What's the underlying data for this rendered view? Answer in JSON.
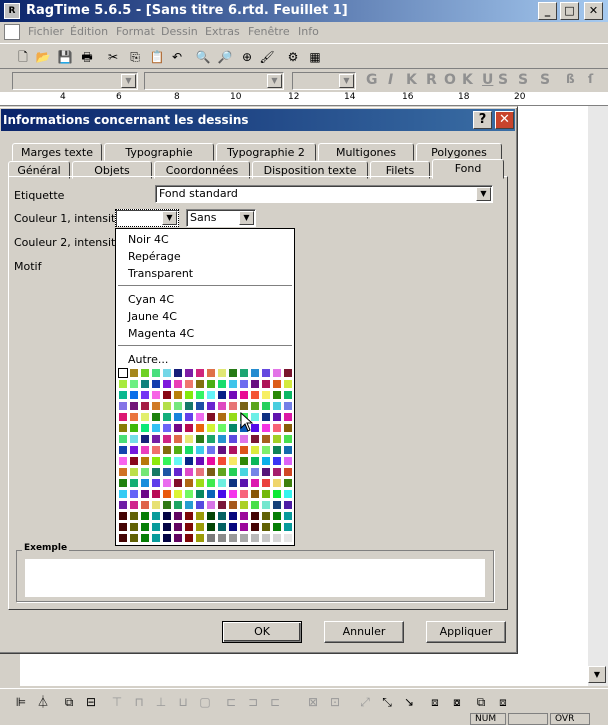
{
  "window": {
    "title": "RagTime 5.6.5 - [Sans titre 6.rtd. Feuillet 1]",
    "minimize": "_",
    "maximize": "□",
    "close": "✕"
  },
  "menu": [
    "Fichier",
    "Édition",
    "Format",
    "Dessin",
    "Extras",
    "Fenêtre",
    "Info"
  ],
  "ruler": [
    "4",
    "6",
    "8",
    "10",
    "12",
    "14",
    "16",
    "18",
    "20"
  ],
  "dialog": {
    "title": "Informations concernant les dessins",
    "help": "?",
    "close": "✕",
    "tabs_back": [
      "Marges texte",
      "Typographie",
      "Typographie 2",
      "Multigones",
      "Polygones"
    ],
    "tabs_front": [
      "Général",
      "Objets",
      "Coordonnées",
      "Disposition texte",
      "Filets",
      "Fond"
    ],
    "active_tab": "Fond",
    "labels": {
      "etiquette": "Etiquette",
      "couleur1": "Couleur 1, intensité",
      "couleur2": "Couleur 2, intensité",
      "motif": "Motif"
    },
    "etiquette_value": "Fond standard",
    "couleur1_value": "",
    "intensite_value": "Sans",
    "dropdown": {
      "group1": [
        "Noir 4C",
        "Repérage",
        "Transparent"
      ],
      "group2": [
        "Cyan 4C",
        "Jaune 4C",
        "Magenta 4C"
      ],
      "other": "Autre..."
    },
    "exemple_label": "Exemple",
    "buttons": {
      "ok": "OK",
      "cancel": "Annuler",
      "apply": "Appliquer"
    }
  },
  "status": [
    "NUM",
    "",
    "OVR"
  ]
}
